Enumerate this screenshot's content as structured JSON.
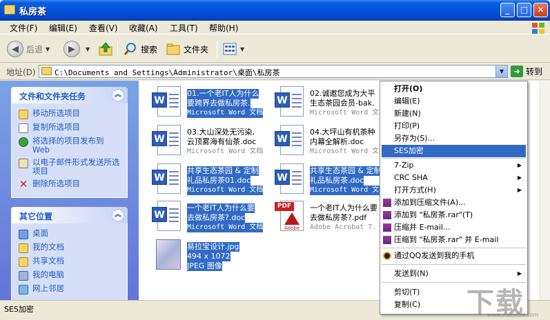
{
  "window": {
    "title": "私房茶",
    "min_label": "_",
    "max_label": "□",
    "close_label": "✕"
  },
  "menubar": [
    "文件(F)",
    "编辑(E)",
    "查看(V)",
    "收藏(A)",
    "工具(T)",
    "帮助(H)"
  ],
  "toolbar": {
    "back": "后退",
    "search": "搜索",
    "folders": "文件夹"
  },
  "address": {
    "label": "地址(D)",
    "path": "C:\\Documents and Settings\\Administrator\\桌面\\私房茶",
    "go": "转到"
  },
  "tasks_panel": {
    "title": "文件和文件夹任务",
    "items": [
      "移动所选项目",
      "复制所选项目",
      "将选择的项目发布到 Web",
      "以电子邮件形式发送所选项目",
      "删除所选项目"
    ]
  },
  "places_panel": {
    "title": "其它位置",
    "items": [
      "桌面",
      "我的文档",
      "共享文档",
      "我的电脑",
      "网上邻居"
    ]
  },
  "files": [
    {
      "line1": "01.一个老IT人为什么",
      "line2": "要跨界去做私房茶.",
      "type": "Microsoft Word 文档",
      "selected": true
    },
    {
      "line1": "02.诚邀您成为大平",
      "line2": "生态茶园会员-bak.",
      "type": "Microsoft Word 文档",
      "selected": false
    },
    {
      "line1": "03.大山深处无污染,",
      "line2": "云顶雾海有仙茶.doc",
      "type": "Microsoft Word 文档",
      "selected": false
    },
    {
      "line1": "04.大坪山有机茶种",
      "line2": "内幕全解析.doc",
      "type": "Microsoft Word 文档",
      "selected": false
    },
    {
      "line1": "共享生态茶园 & 定制",
      "line2": "礼品私房茶01.doc",
      "type": "Microsoft Word 文档",
      "selected": true
    },
    {
      "line1": "共享生态茶园 & 定制",
      "line2": "礼品私房茶.doc",
      "type": "Microsoft Word 文档",
      "selected": true
    },
    {
      "line1": "一个老IT人为什么要",
      "line2": "去做私房茶?.doc",
      "type": "Microsoft Word 文档",
      "selected": true
    },
    {
      "line1": "一个老IT人为什么要",
      "line2": "去做私房茶?.pdf",
      "type": "Adobe Acrobat 7.",
      "selected": false
    },
    {
      "line1": "易拉宝设计.jpg",
      "line2": "494 x 1072",
      "type": "JPEG 图像",
      "selected": true
    }
  ],
  "status": {
    "text": "SES加密"
  },
  "context_menu": [
    {
      "label": "打开(O)",
      "bold": true
    },
    {
      "label": "编辑(E)"
    },
    {
      "label": "新建(N)"
    },
    {
      "label": "打印(P)"
    },
    {
      "label": "另存为(S)..."
    },
    {
      "label": "SES加密",
      "highlight": true
    },
    {
      "label": "7-Zip",
      "submenu": true
    },
    {
      "label": "CRC SHA",
      "submenu": true
    },
    {
      "label": "打开方式(H)",
      "submenu": true
    },
    {
      "label": "添加到压缩文件(A)...",
      "icon": "winrar-icon"
    },
    {
      "label": "添加到 \"私房茶.rar\"(T)",
      "icon": "winrar-icon"
    },
    {
      "label": "压缩并 E-mail...",
      "icon": "winrar-icon"
    },
    {
      "label": "压缩到 \"私房茶.rar\" 并 E-mail",
      "icon": "winrar-icon"
    },
    {
      "label": "通过QQ发送到我的手机",
      "icon": "qq-icon"
    },
    {
      "label": "发送到(N)",
      "submenu": true
    },
    {
      "label": "剪切(T)"
    },
    {
      "label": "复制(C)"
    }
  ],
  "watermark": {
    "text": "下载吧",
    "url": "www.xiazaiba.com"
  },
  "colors": {
    "selection": "#316ac5",
    "titlebar": "#0053d7",
    "link": "#215dc6"
  }
}
